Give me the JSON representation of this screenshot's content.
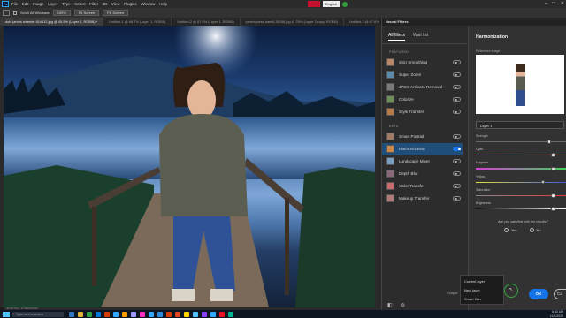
{
  "menubar": {
    "logo_text": "Ps",
    "items": [
      "File",
      "Edit",
      "Image",
      "Layer",
      "Type",
      "Select",
      "Filter",
      "3D",
      "View",
      "Plugins",
      "Window",
      "Help"
    ],
    "language": "English"
  },
  "options_bar": {
    "scroll_all": "Scroll All Windows",
    "zoom": "100%",
    "fit_screen": "Fit Screen",
    "fill_screen": "Fill Screen"
  },
  "doc_tabs": [
    {
      "label": "dole james wheeler 614612.jpg @ 45.5% (Layer 2, RGB/8) *",
      "active": true
    },
    {
      "label": "Untitled-1 @ 66.7% (Layer 1, RGB/8)",
      "active": false
    },
    {
      "label": "Untitled-2 @ 67.6% (Layer 1, RGB/8)",
      "active": false
    },
    {
      "label": "pexels-bess-hamiti-35188.jpg @ 25% (Layer 2 copy, RGB/8)",
      "active": false
    },
    {
      "label": "Untitled-3 @ 67.6% (Layer 2 copy 2, RGB/8)",
      "active": false
    }
  ],
  "status": "45.5%   Doc: 17.2M/130.6M",
  "neural_filters": {
    "header": "Neural Filters",
    "tabs": [
      {
        "label": "All filters",
        "active": true
      },
      {
        "label": "Wait list",
        "active": false
      }
    ],
    "featured_label": "FEATURED",
    "featured": [
      {
        "name": "Skin Smoothing",
        "thumb": "#b98866"
      },
      {
        "name": "Super Zoom",
        "thumb": "#5d8aa8"
      },
      {
        "name": "JPEG Artifacts Removal",
        "thumb": "#7a7a7a"
      },
      {
        "name": "Colorize",
        "thumb": "#6f8f5a"
      },
      {
        "name": "Style Transfer",
        "thumb": "#b57a48"
      }
    ],
    "beta_label": "BETA",
    "beta": [
      {
        "name": "Smart Portrait",
        "thumb": "#a07a64",
        "on": false
      },
      {
        "name": "Harmonization",
        "thumb": "#c9894c",
        "on": true
      },
      {
        "name": "Landscape Mixer",
        "thumb": "#7b9fc2",
        "on": false
      },
      {
        "name": "Depth Blur",
        "thumb": "#8a6a7a",
        "on": false
      },
      {
        "name": "Color Transfer",
        "thumb": "#c96b6b",
        "on": false
      },
      {
        "name": "Makeup Transfer",
        "thumb": "#b07a7a",
        "on": false
      }
    ],
    "output_label": "Output"
  },
  "harmonization": {
    "title": "Harmonization",
    "reference_label": "Reference image",
    "layer_select": "Layer 1",
    "sliders": [
      {
        "label": "Strength",
        "value": 0.8,
        "gradient": "#6a6a6a"
      },
      {
        "label": "Cyan",
        "value": 0.84,
        "gradient": "linear-gradient(90deg,#2bd4d4,#d44a4a)"
      },
      {
        "label": "Magenta",
        "value": 0.84,
        "gradient": "linear-gradient(90deg,#d43fd4,#3fd45a)"
      },
      {
        "label": "Yellow",
        "value": 0.73,
        "gradient": "linear-gradient(90deg,#e6e03a,#3a56e6)"
      },
      {
        "label": "Saturation",
        "value": 0.84,
        "gradient": "linear-gradient(90deg,#888,#e63a3a)"
      },
      {
        "label": "Brightness",
        "value": 0.84,
        "gradient": "linear-gradient(90deg,#111,#fff)"
      }
    ],
    "question": "Are you satisfied with the results?",
    "yes": "Yes",
    "no": "No",
    "ok": "OK",
    "cancel": "Ca"
  },
  "output_dropdown": {
    "options": [
      "Current layer",
      "New layer",
      "Smart filter"
    ],
    "selected": "New layer"
  },
  "taskbar": {
    "search_placeholder": "Type here to search",
    "time": "6:40 AM",
    "date": "11/5/2020",
    "icons": [
      "#3277bc",
      "#e0b43a",
      "#2ea043",
      "#0078d4",
      "#d83b01",
      "#31a8ff",
      "#ff9a00",
      "#9999ff",
      "#ff2bc2",
      "#31a8ff",
      "#2b8cdc",
      "#d83b01",
      "#e24329",
      "#ffd400",
      "#4cc2ff",
      "#8a3ffc",
      "#31a8ff",
      "#e81123",
      "#00b294"
    ]
  }
}
